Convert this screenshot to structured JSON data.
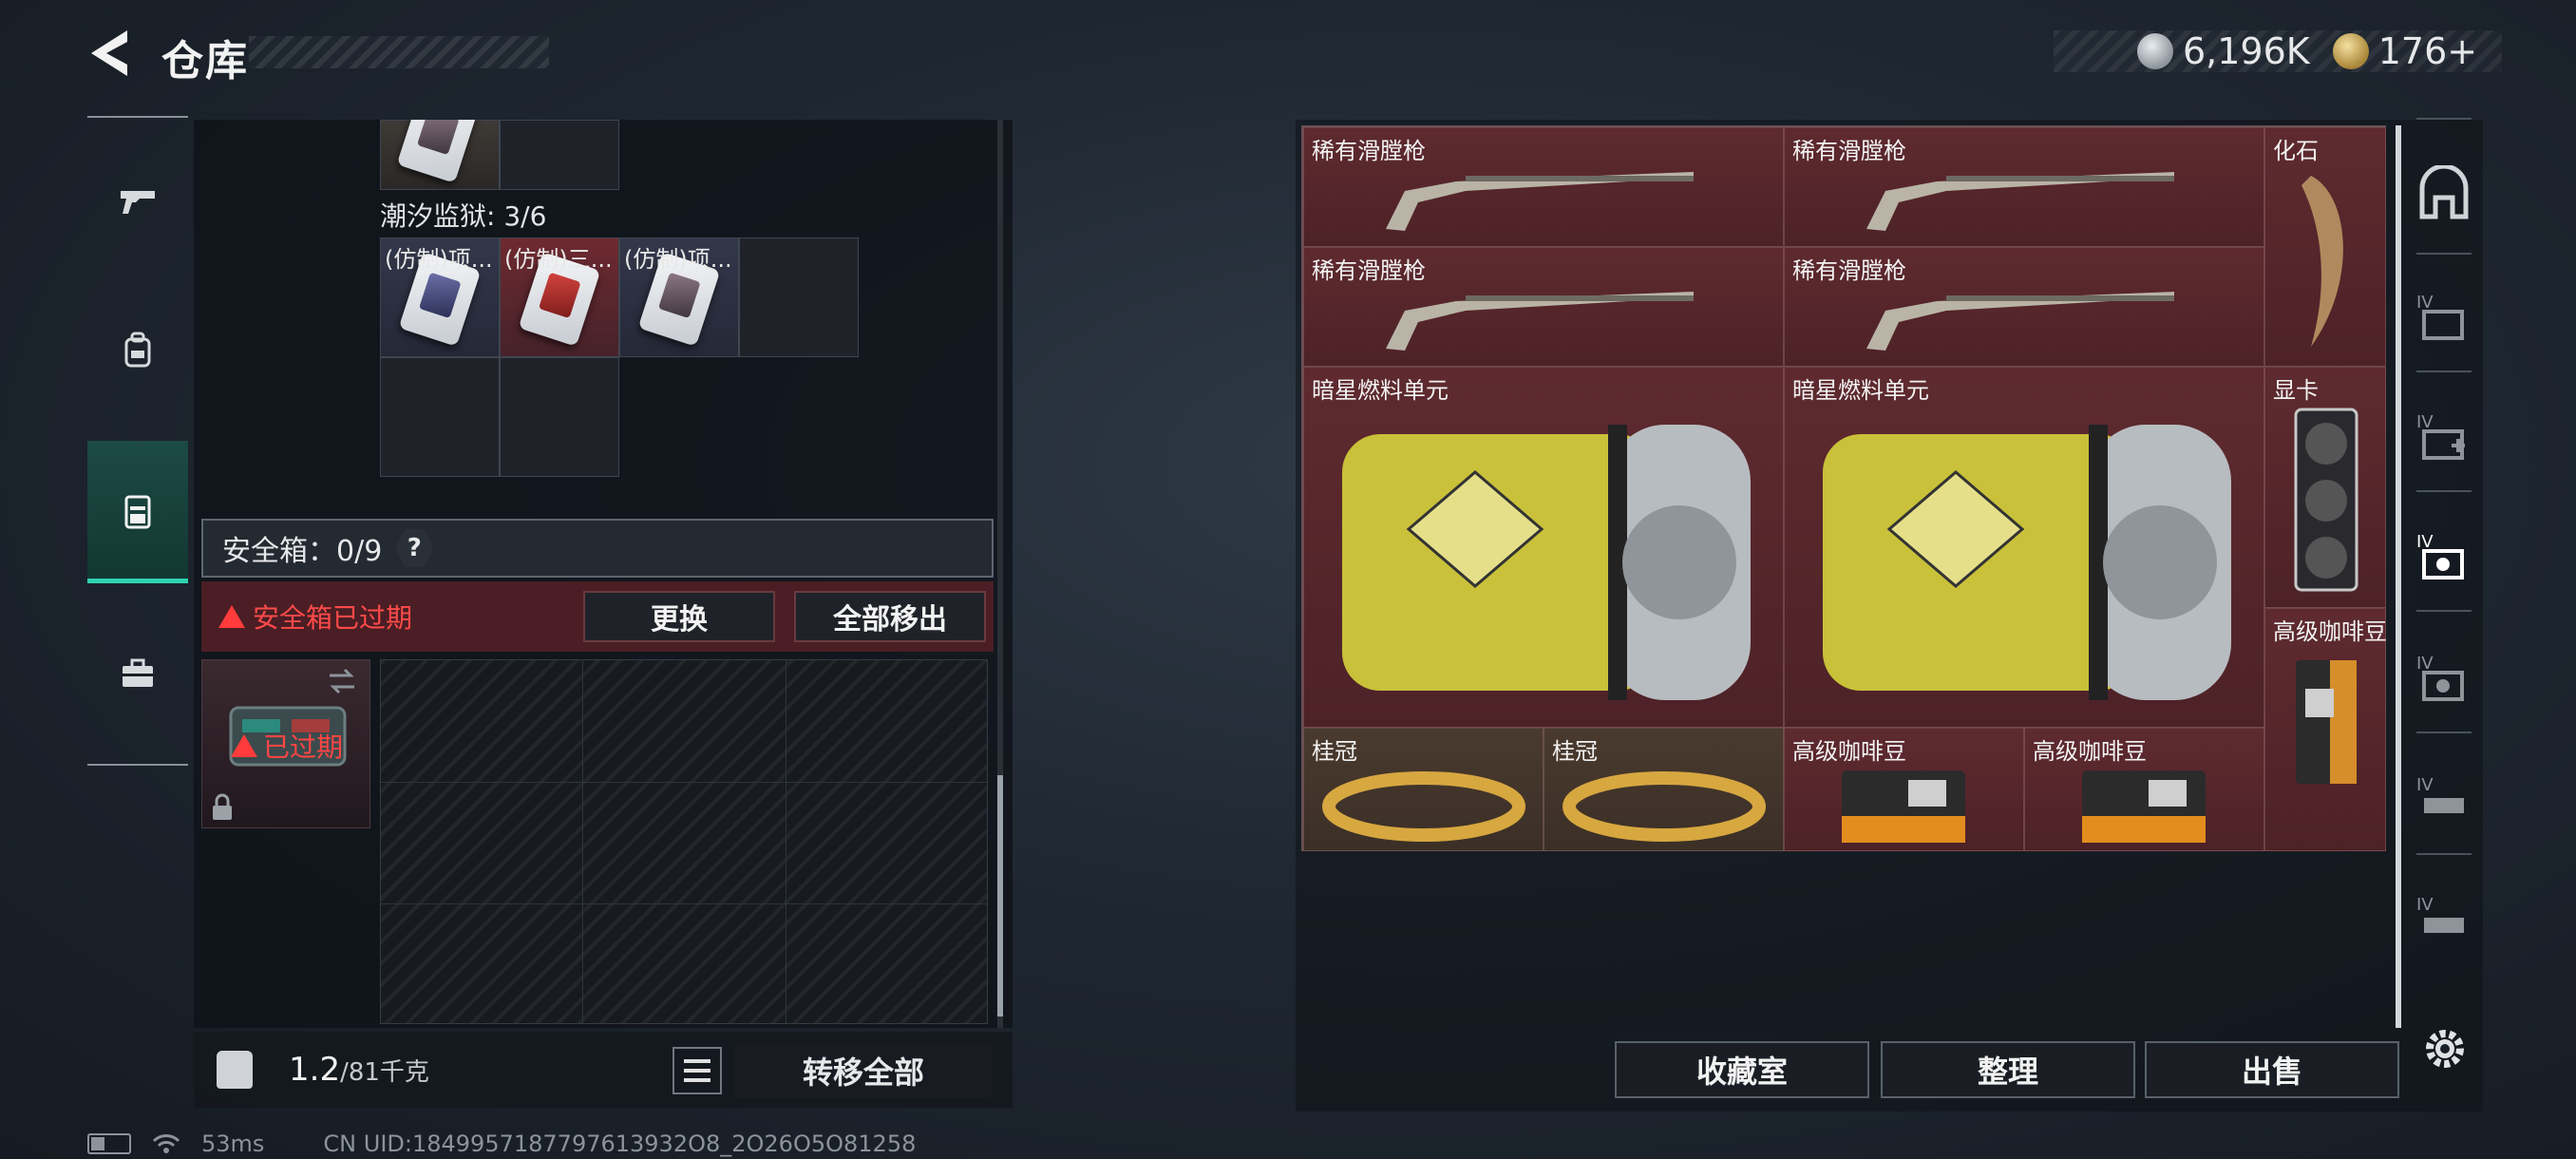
{
  "header": {
    "title": "仓库",
    "currencies": [
      {
        "icon": "silver-coin-icon",
        "value": "6,196K"
      },
      {
        "icon": "gold-coin-icon",
        "value": "176+"
      }
    ]
  },
  "left_rail": {
    "items": [
      {
        "name": "weapon",
        "icon": "pistol-icon",
        "active": false
      },
      {
        "name": "backpack",
        "icon": "backpack-icon",
        "active": false
      },
      {
        "name": "chest-rig",
        "icon": "chest-rig-icon",
        "active": true
      },
      {
        "name": "toolbox",
        "icon": "toolbox-icon",
        "active": false
      }
    ]
  },
  "left_panel": {
    "container_label": "潮汐监狱: 3/6",
    "cards": [
      {
        "label": "(仿制)项...",
        "color": "blue"
      },
      {
        "label": "(仿制)三...",
        "color": "red"
      },
      {
        "label": "(仿制)项...",
        "color": "blue"
      }
    ],
    "safebox": {
      "label": "安全箱：0/9",
      "help": "?",
      "expired_warning": "安全箱已过期",
      "replace_button": "更换",
      "remove_all_button": "全部移出",
      "item_status": "已过期"
    }
  },
  "bottom_bar": {
    "weight": "1.2",
    "weight_capacity": "/81千克",
    "transfer_all": "转移全部"
  },
  "stash": {
    "items": [
      {
        "label": "稀有滑膛枪",
        "kind": "musket"
      },
      {
        "label": "稀有滑膛枪",
        "kind": "musket"
      },
      {
        "label": "化石",
        "kind": "fossil"
      },
      {
        "label": "稀有滑膛枪",
        "kind": "musket"
      },
      {
        "label": "稀有滑膛枪",
        "kind": "musket"
      },
      {
        "label": "暗星燃料单元",
        "kind": "fuel-cell"
      },
      {
        "label": "暗星燃料单元",
        "kind": "fuel-cell"
      },
      {
        "label": "显卡",
        "kind": "gpu"
      },
      {
        "label": "高级咖啡豆",
        "kind": "coffee"
      },
      {
        "label": "桂冠",
        "kind": "laurel"
      },
      {
        "label": "桂冠",
        "kind": "laurel"
      },
      {
        "label": "高级咖啡豆",
        "kind": "coffee"
      },
      {
        "label": "高级咖啡豆",
        "kind": "coffee"
      }
    ]
  },
  "actions": {
    "collection_room": "收藏室",
    "organize": "整理",
    "sell": "出售"
  },
  "status": {
    "ping": "53ms",
    "uid": "CN UID:1849957187797613932O8_2O26O5O81258"
  },
  "colors": {
    "accent": "#2fd3b0",
    "warning": "#ff4a4a",
    "stash_bg": "#5a262b"
  }
}
